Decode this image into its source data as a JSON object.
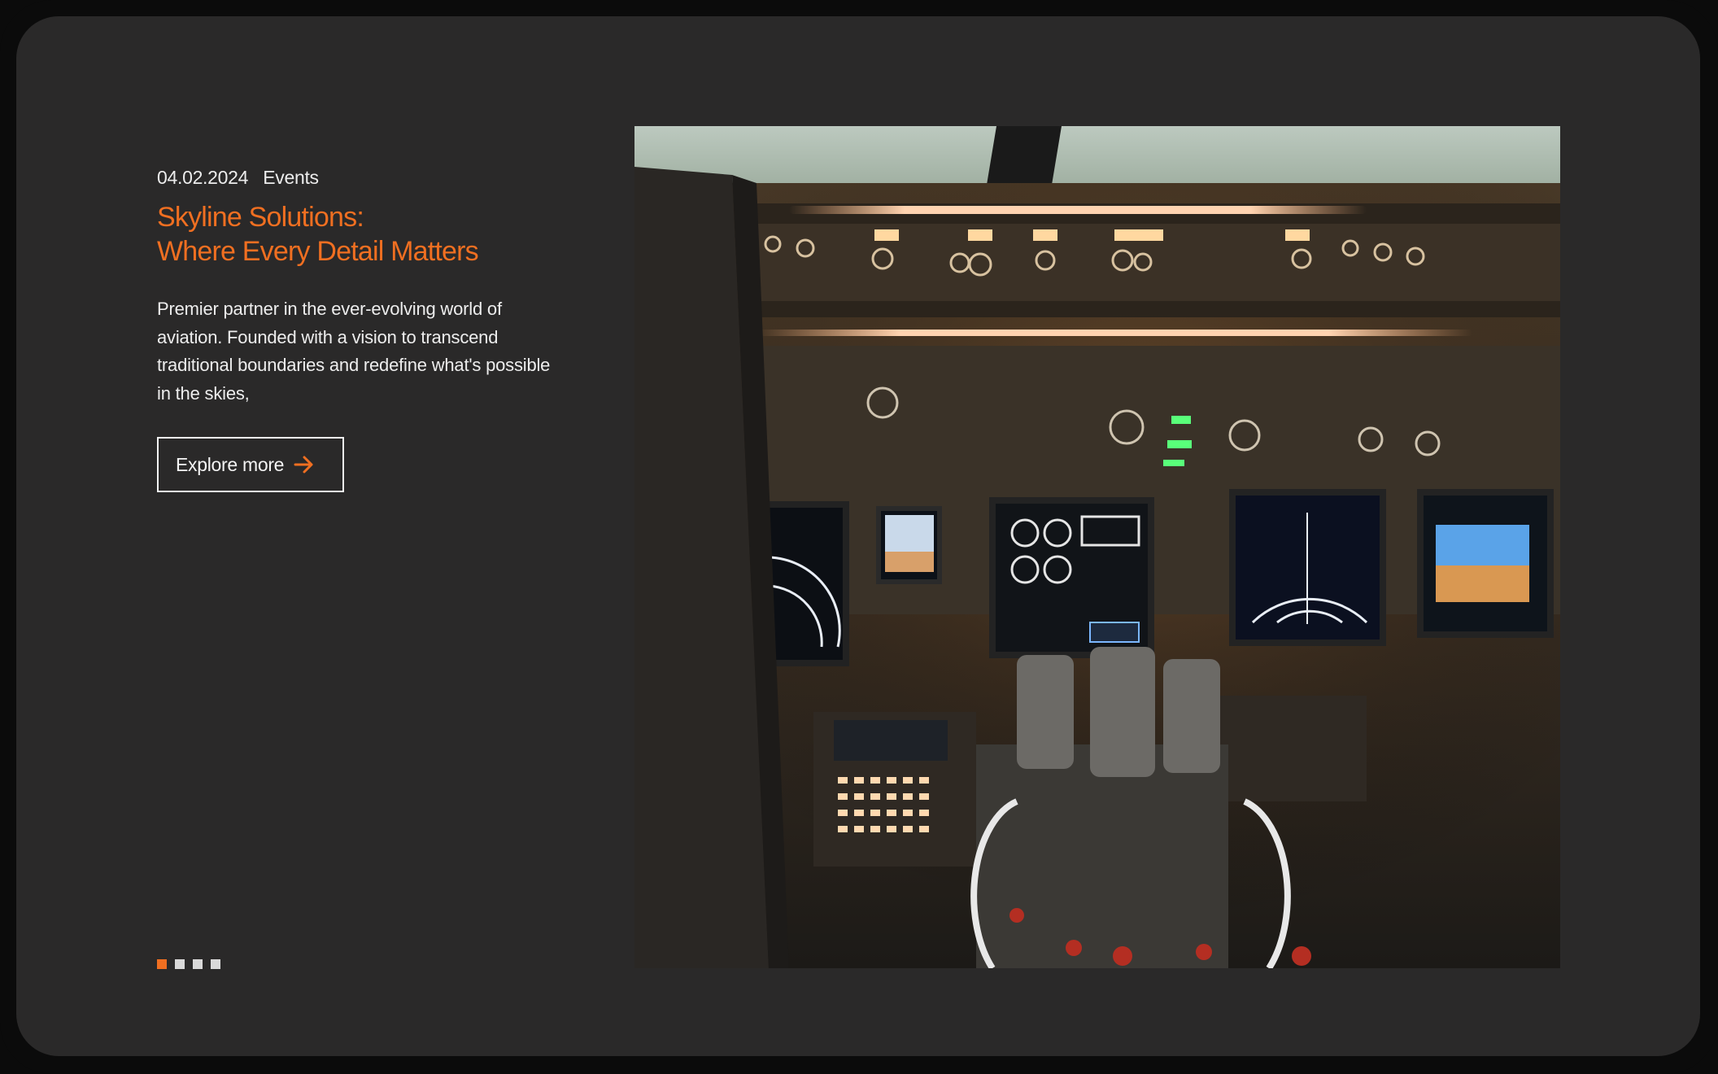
{
  "article": {
    "date": "04.02.2024",
    "category": "Events",
    "title_line1": "Skyline Solutions:",
    "title_line2": "Where Every Detail Matters",
    "description": "Premier partner in the ever-evolving world of aviation. Founded with a vision to transcend traditional boundaries and redefine what's possible in the skies,",
    "cta_label": "Explore more"
  },
  "carousel": {
    "total": 4,
    "active_index": 0
  },
  "image": {
    "subject": "aircraft cockpit flight deck"
  },
  "colors": {
    "accent": "#f06f21",
    "card_background": "#2a2929",
    "frame": "#0b0b0b",
    "text": "#ececec"
  }
}
